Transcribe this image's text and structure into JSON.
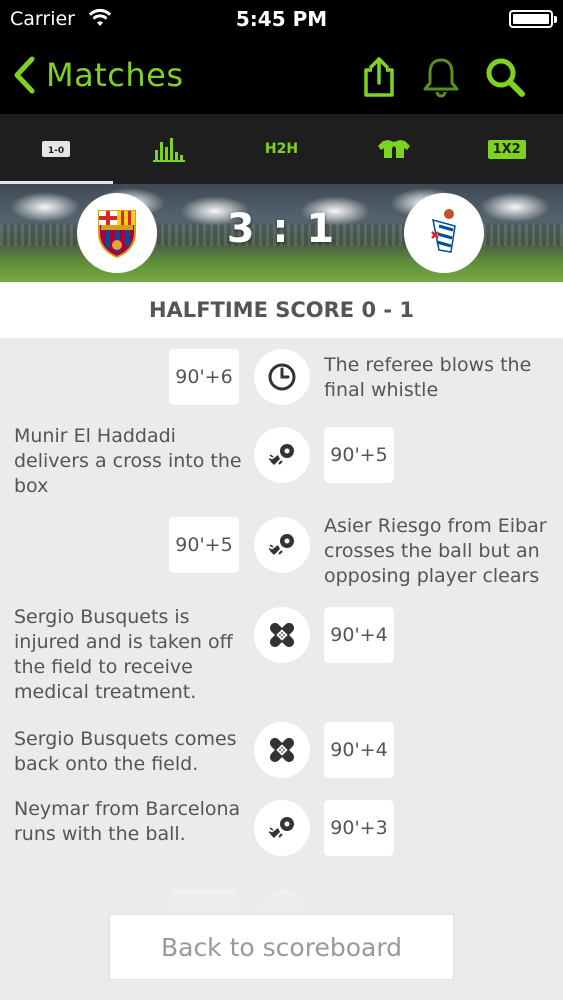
{
  "status_bar": {
    "carrier": "Carrier",
    "time": "5:45 PM"
  },
  "nav": {
    "back_label": "Matches",
    "icons": [
      "share-icon",
      "bell-icon",
      "search-icon"
    ],
    "accent": "#7ed321"
  },
  "tabs": [
    {
      "icon": "scoreboard-icon",
      "active": true
    },
    {
      "icon": "stats-icon",
      "active": false
    },
    {
      "label": "H2H",
      "active": false
    },
    {
      "icon": "jersey-icon",
      "active": false
    },
    {
      "label": "1X2",
      "active": false
    }
  ],
  "match": {
    "home_team_logo": "barcelona-logo",
    "away_team_logo": "eibar-logo",
    "score": "3 : 1"
  },
  "halftime_label": "HALFTIME SCORE 0 - 1",
  "events": [
    {
      "side": "away",
      "time": "90'+6",
      "icon": "clock-icon",
      "text": "The referee blows the final whistle"
    },
    {
      "side": "home",
      "time": "90'+5",
      "icon": "cross-ball-icon",
      "text": "Munir El Haddadi delivers a cross into the box"
    },
    {
      "side": "away",
      "time": "90'+5",
      "icon": "cross-ball-icon",
      "text": "Asier Riesgo from Eibar crosses the ball but an opposing player clears"
    },
    {
      "side": "home",
      "time": "90'+4",
      "icon": "bandage-icon",
      "text": "Sergio Busquets is injured and is taken off the field to receive medical treatment."
    },
    {
      "side": "home",
      "time": "90'+4",
      "icon": "bandage-icon",
      "text": "Sergio Busquets comes back onto the field."
    },
    {
      "side": "home",
      "time": "90'+3",
      "icon": "cross-ball-icon",
      "text": "Neymar from Barcelona runs with the ball."
    }
  ],
  "back_button_label": "Back to scoreboard"
}
